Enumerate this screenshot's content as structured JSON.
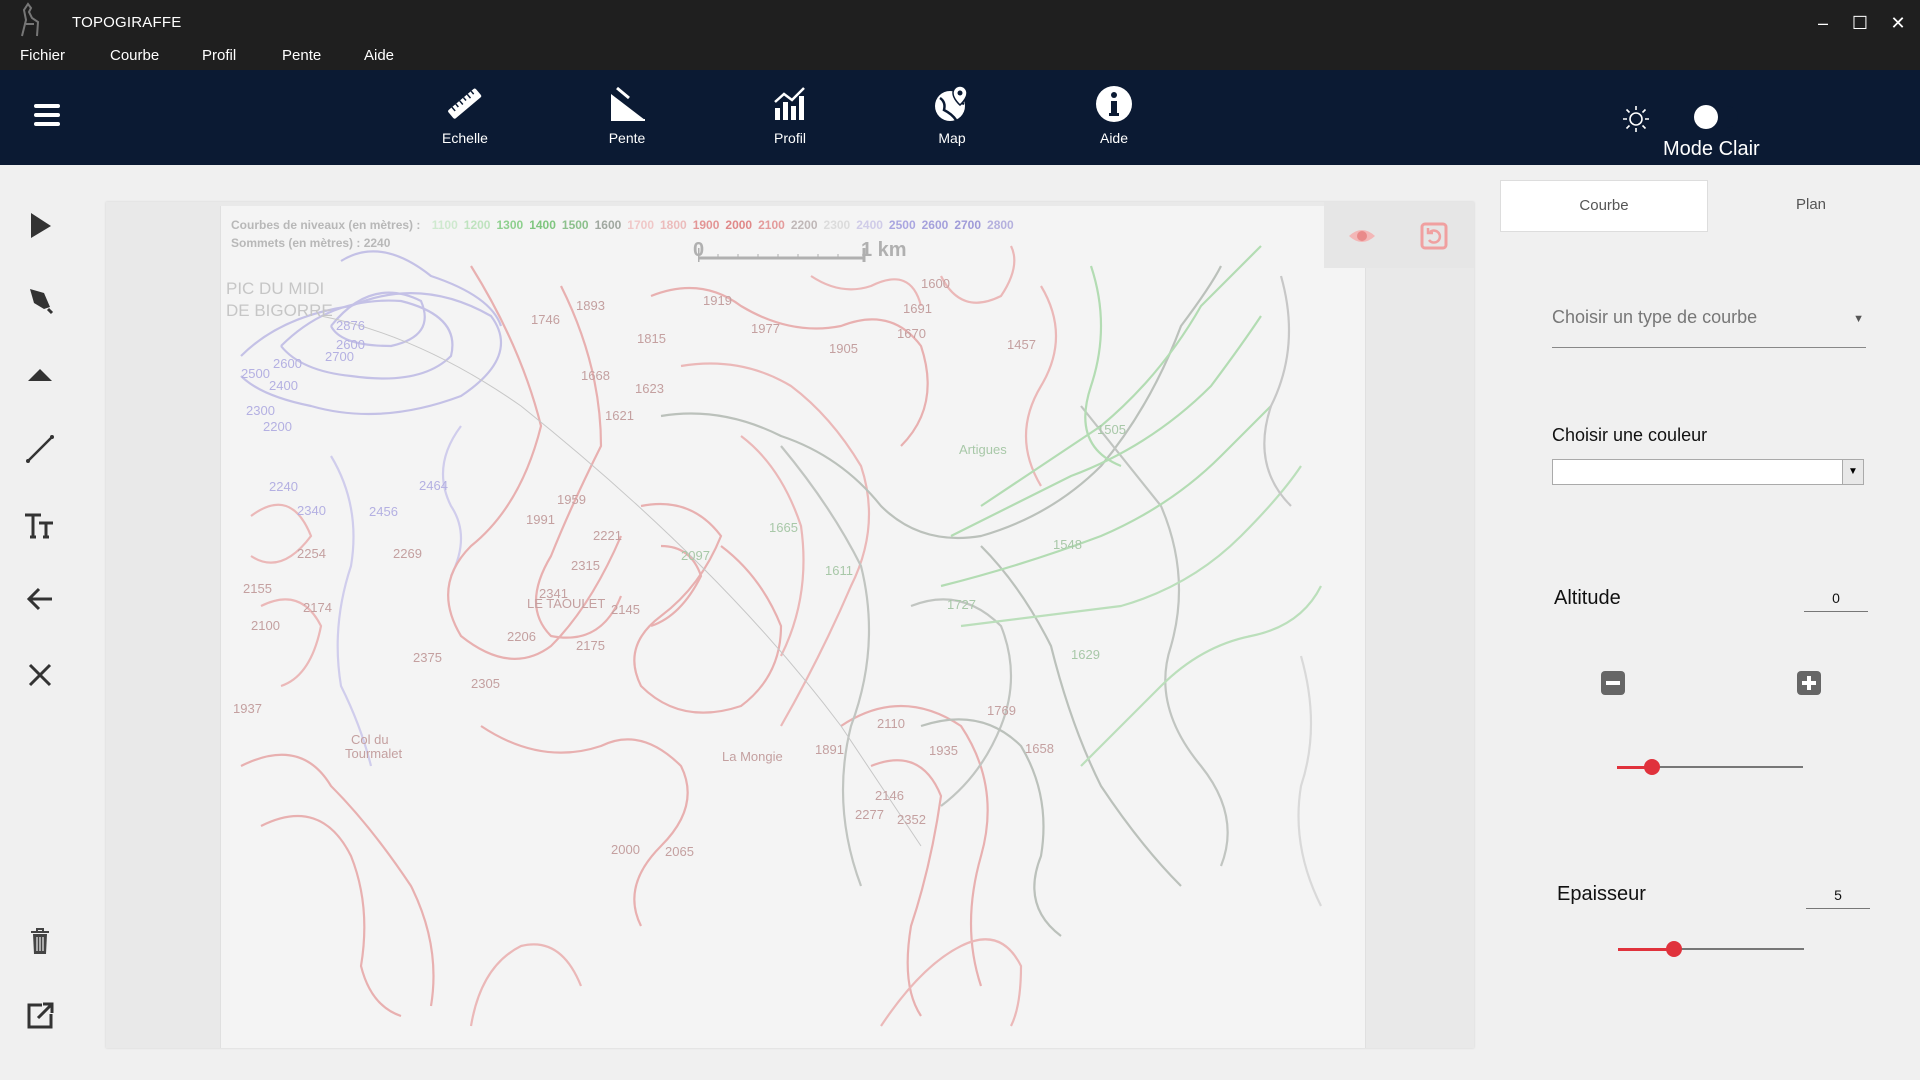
{
  "window": {
    "title": "TOPOGIRAFFE",
    "minimize": "–",
    "maximize": "☐",
    "close": "✕"
  },
  "menu": [
    "Fichier",
    "Courbe",
    "Profil",
    "Pente",
    "Aide"
  ],
  "toolbar": {
    "tools": [
      {
        "label": "Echelle",
        "icon": "ruler-icon"
      },
      {
        "label": "Pente",
        "icon": "slope-icon"
      },
      {
        "label": "Profil",
        "icon": "bar-chart-icon"
      },
      {
        "label": "Map",
        "icon": "globe-pin-icon"
      },
      {
        "label": "Aide",
        "icon": "info-icon"
      }
    ],
    "theme_label": "Mode Clair",
    "theme_toggle_on": false
  },
  "sidebar_tools": [
    "pointer-icon",
    "pen-icon",
    "triangle-up-icon",
    "line-icon",
    "text-icon",
    "back-arrow-icon",
    "close-icon",
    "trash-icon",
    "export-icon"
  ],
  "map": {
    "legend_line1": "Courbes de niveaux (en mètres) :",
    "legend_line2": "Sommets (en mètres) : 2240",
    "legend_levels": [
      "1100",
      "1200",
      "1300",
      "1400",
      "1500",
      "1600",
      "1700",
      "1800",
      "1900",
      "2000",
      "2100",
      "2200",
      "2300",
      "2400",
      "2500",
      "2600",
      "2700",
      "2800"
    ],
    "scale_start": "0",
    "scale_end": "1 km",
    "title_line1": "PIC DU MIDI",
    "title_line2": "DE BIGORRE",
    "labels": [
      "2876",
      "2600",
      "2700",
      "2500",
      "2600",
      "2400",
      "2300",
      "2200",
      "2240",
      "2340",
      "2464",
      "2456",
      "1746",
      "1893",
      "1815",
      "1919",
      "1977",
      "1905",
      "1691",
      "1670",
      "1600",
      "1668",
      "1623",
      "1621",
      "1959",
      "1991",
      "2221",
      "2315",
      "2341",
      "LE TAOULET",
      "2145",
      "2206",
      "2175",
      "2269",
      "2254",
      "2155",
      "2174",
      "2100",
      "2375",
      "2305",
      "1937",
      "Col du",
      "Tourmalet",
      "1665",
      "1611",
      "2097",
      "Artigues",
      "1505",
      "1548",
      "1727",
      "1629",
      "1769",
      "1658",
      "2110",
      "1935",
      "1891",
      "2146",
      "2277",
      "2352",
      "La Mongie",
      "2065",
      "2000",
      "1457"
    ],
    "colors": {
      "red": "#e59a9a",
      "purple": "#b4b0e2",
      "green": "#9ed59e",
      "gray": "#a8b0a8"
    }
  },
  "panel": {
    "tab_courbe": "Courbe",
    "tab_plan": "Plan",
    "curve_type_placeholder": "Choisir un type de courbe",
    "color_label": "Choisir une couleur",
    "altitude_label": "Altitude",
    "altitude_value": "0",
    "altitude_slider": 0.19,
    "epaisseur_label": "Epaisseur",
    "epaisseur_value": "5",
    "epaisseur_slider": 0.3,
    "accent": "#e0323c"
  }
}
